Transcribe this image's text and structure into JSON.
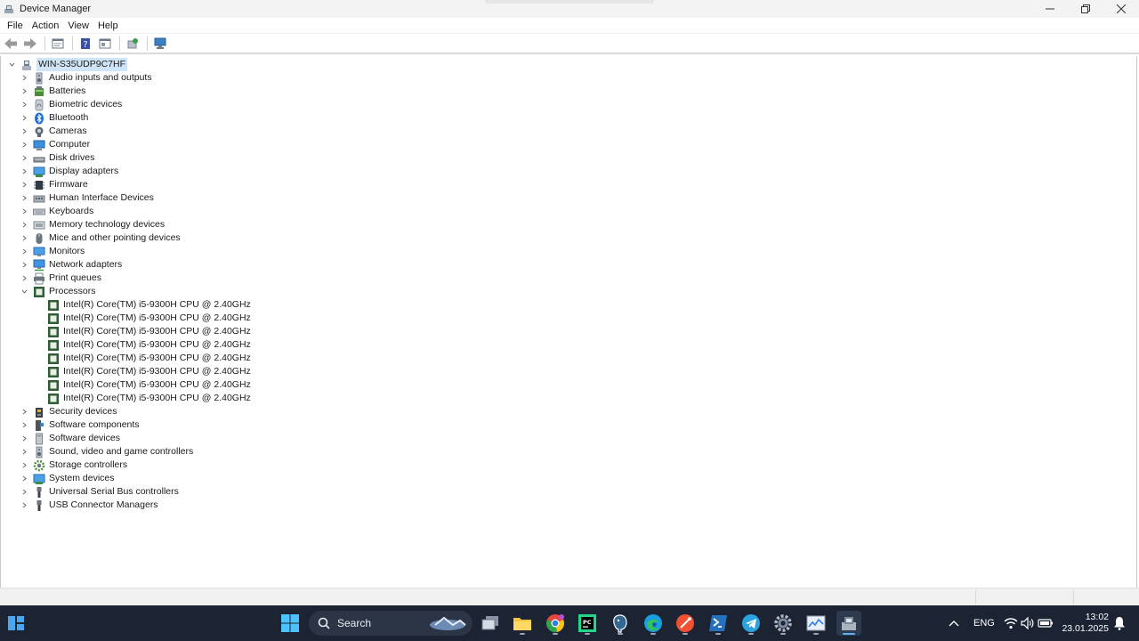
{
  "window": {
    "title": "Device Manager",
    "controls": [
      "minimize",
      "maximize",
      "close"
    ]
  },
  "menu": [
    "File",
    "Action",
    "View",
    "Help"
  ],
  "toolbar": [
    "back-arrow-icon",
    "forward-arrow-icon",
    "properties-icon",
    "help-icon",
    "view-icon",
    "update-driver-icon",
    "scan-hardware-icon"
  ],
  "tree": {
    "root": "WIN-S35UDP9C7HF",
    "categories": [
      {
        "label": "Audio inputs and outputs",
        "icon": "speaker-icon"
      },
      {
        "label": "Batteries",
        "icon": "battery-icon"
      },
      {
        "label": "Biometric devices",
        "icon": "fingerprint-icon"
      },
      {
        "label": "Bluetooth",
        "icon": "bluetooth-icon"
      },
      {
        "label": "Cameras",
        "icon": "camera-icon"
      },
      {
        "label": "Computer",
        "icon": "computer-icon"
      },
      {
        "label": "Disk drives",
        "icon": "disk-icon"
      },
      {
        "label": "Display adapters",
        "icon": "display-adapter-icon"
      },
      {
        "label": "Firmware",
        "icon": "firmware-icon"
      },
      {
        "label": "Human Interface Devices",
        "icon": "hid-icon"
      },
      {
        "label": "Keyboards",
        "icon": "keyboard-icon"
      },
      {
        "label": "Memory technology devices",
        "icon": "memory-icon"
      },
      {
        "label": "Mice and other pointing devices",
        "icon": "mouse-icon"
      },
      {
        "label": "Monitors",
        "icon": "monitor-icon"
      },
      {
        "label": "Network adapters",
        "icon": "network-icon"
      },
      {
        "label": "Print queues",
        "icon": "printer-icon"
      },
      {
        "label": "Processors",
        "icon": "processor-icon",
        "expanded": true,
        "children": [
          "Intel(R) Core(TM) i5-9300H CPU @ 2.40GHz",
          "Intel(R) Core(TM) i5-9300H CPU @ 2.40GHz",
          "Intel(R) Core(TM) i5-9300H CPU @ 2.40GHz",
          "Intel(R) Core(TM) i5-9300H CPU @ 2.40GHz",
          "Intel(R) Core(TM) i5-9300H CPU @ 2.40GHz",
          "Intel(R) Core(TM) i5-9300H CPU @ 2.40GHz",
          "Intel(R) Core(TM) i5-9300H CPU @ 2.40GHz",
          "Intel(R) Core(TM) i5-9300H CPU @ 2.40GHz"
        ]
      },
      {
        "label": "Security devices",
        "icon": "security-icon"
      },
      {
        "label": "Software components",
        "icon": "software-component-icon"
      },
      {
        "label": "Software devices",
        "icon": "software-device-icon"
      },
      {
        "label": "Sound, video and game controllers",
        "icon": "speaker-icon"
      },
      {
        "label": "Storage controllers",
        "icon": "storage-icon"
      },
      {
        "label": "System devices",
        "icon": "system-icon"
      },
      {
        "label": "Universal Serial Bus controllers",
        "icon": "usb-icon"
      },
      {
        "label": "USB Connector Managers",
        "icon": "usb-icon"
      }
    ]
  },
  "taskbar": {
    "search_placeholder": "Search",
    "apps": [
      "start-icon",
      "task-view-icon",
      "file-explorer-icon",
      "chrome-icon",
      "pycharm-icon",
      "postgres-icon",
      "edge-icon",
      "git-icon",
      "powershell-icon",
      "telegram-icon",
      "settings-icon",
      "resource-monitor-icon",
      "device-manager-icon"
    ],
    "active_app": "device-manager-icon",
    "language": "ENG",
    "time": "13:02",
    "date": "23.01.2025"
  },
  "colors": {
    "selection": "#cfe4f7",
    "taskbar_bg": "#1c2434",
    "accent": "#5fb2f2"
  }
}
